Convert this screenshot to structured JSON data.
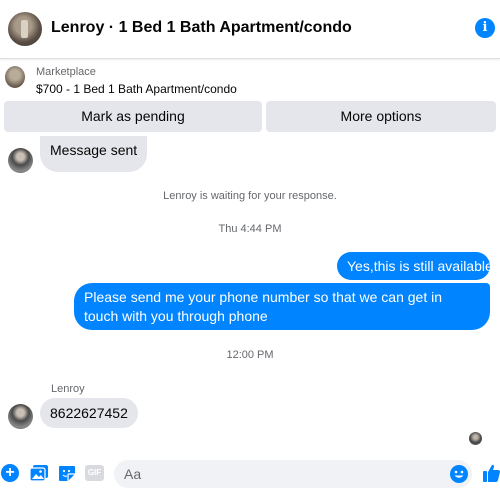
{
  "header": {
    "title": "Lenroy · 1 Bed 1 Bath Apartment/condo",
    "info_icon": "info-icon",
    "info_glyph": "i"
  },
  "listing": {
    "label": "Marketplace",
    "price_title": "$700 - 1 Bed 1 Bath Apartment/condo"
  },
  "actions": {
    "mark_pending": "Mark as pending",
    "more_options": "More options"
  },
  "messages": [
    {
      "type": "incoming",
      "text": "Message sent"
    },
    {
      "type": "system",
      "text": "Lenroy is waiting for your response."
    },
    {
      "type": "timestamp",
      "text": "Thu 4:44 PM"
    },
    {
      "type": "outgoing",
      "text": "Yes,this is still available"
    },
    {
      "type": "outgoing",
      "text": "Please send me your phone  number so that we can get in touch with you through phone"
    },
    {
      "type": "timestamp",
      "text": "12:00 PM"
    },
    {
      "type": "sender",
      "text": "Lenroy"
    },
    {
      "type": "incoming",
      "text": "8622627452"
    }
  ],
  "composer": {
    "placeholder": "Aa",
    "plus_glyph": "+",
    "gif_label": "GIF",
    "icons": [
      "plus-icon",
      "photo-icon",
      "sticker-icon",
      "gif-icon",
      "emoji-icon",
      "like-icon"
    ]
  },
  "colors": {
    "accent": "#0084ff",
    "bubble_in": "#e4e6eb",
    "button_bg": "#e4e6eb",
    "secondary_text": "#65676b"
  }
}
